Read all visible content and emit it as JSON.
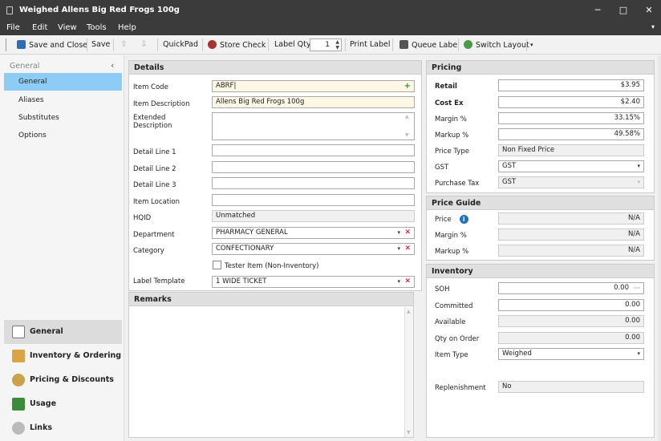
{
  "window": {
    "title": "Weighed Allens Big Red Frogs 100g",
    "minimize": "─",
    "maximize": "□",
    "close": "✕"
  },
  "menu": {
    "file": "File",
    "edit": "Edit",
    "view": "View",
    "tools": "Tools",
    "help": "Help",
    "overflow": "▾"
  },
  "toolbar": {
    "save_close": "Save and Close",
    "save": "Save",
    "quickpad": "QuickPad",
    "store_check": "Store Check",
    "label_qty_label": "Label Qty",
    "label_qty_value": "1",
    "print_label": "Print Label",
    "queue_label": "Queue Label",
    "switch_layout": "Switch Layout"
  },
  "sidebar": {
    "header": "General",
    "collapse": "‹",
    "items": [
      {
        "label": "General",
        "selected": true
      },
      {
        "label": "Aliases",
        "selected": false
      },
      {
        "label": "Substitutes",
        "selected": false
      },
      {
        "label": "Options",
        "selected": false
      }
    ],
    "nav": [
      {
        "label": "General",
        "icon": "document-icon",
        "selected": true
      },
      {
        "label": "Inventory & Ordering",
        "icon": "box-icon",
        "selected": false
      },
      {
        "label": "Pricing & Discounts",
        "icon": "money-bag-icon",
        "selected": false
      },
      {
        "label": "Usage",
        "icon": "chart-icon",
        "selected": false
      },
      {
        "label": "Links",
        "icon": "link-icon",
        "selected": false
      }
    ]
  },
  "details": {
    "header": "Details",
    "item_code_label": "Item Code",
    "item_code": "ABRF",
    "add": "+",
    "item_description_label": "Item Description",
    "item_description": "Allens Big Red Frogs 100g",
    "extended_description_label_1": "Extended",
    "extended_description_label_2": "Description",
    "extended_description": "",
    "detail_line_1_label": "Detail Line 1",
    "detail_line_1": "",
    "detail_line_2_label": "Detail Line 2",
    "detail_line_2": "",
    "detail_line_3_label": "Detail Line 3",
    "detail_line_3": "",
    "item_location_label": "Item Location",
    "item_location": "",
    "hqid_label": "HQID",
    "hqid": "Unmatched",
    "department_label": "Department",
    "department": "PHARMACY GENERAL",
    "category_label": "Category",
    "category": "CONFECTIONARY",
    "tester_label": "Tester Item (Non-Inventory)",
    "label_template_label": "Label Template",
    "label_template": "1 WIDE TICKET",
    "dropdown": "▾",
    "clear": "✕"
  },
  "remarks": {
    "header": "Remarks",
    "value": ""
  },
  "pricing": {
    "header": "Pricing",
    "retail_label": "Retail",
    "retail": "$3.95",
    "cost_label": "Cost Ex",
    "cost": "$2.40",
    "margin_label": "Margin %",
    "margin": "33.15%",
    "markup_label": "Markup %",
    "markup": "49.58%",
    "price_type_label": "Price Type",
    "price_type": "Non Fixed Price",
    "gst_label": "GST",
    "gst": "GST",
    "purchase_tax_label": "Purchase Tax",
    "purchase_tax": "GST"
  },
  "price_guide": {
    "header": "Price Guide",
    "price_label": "Price",
    "info": "i",
    "price": "N/A",
    "margin_label": "Margin %",
    "margin": "N/A",
    "markup_label": "Markup %",
    "markup": "N/A"
  },
  "inventory": {
    "header": "Inventory",
    "soh_label": "SOH",
    "soh": "0.00",
    "soh_more": "···",
    "committed_label": "Committed",
    "committed": "0.00",
    "available_label": "Available",
    "available": "0.00",
    "qty_on_order_label": "Qty on Order",
    "qty_on_order": "0.00",
    "item_type_label": "Item Type",
    "item_type": "Weighed",
    "replenishment_label": "Replenishment",
    "replenishment": "No"
  }
}
